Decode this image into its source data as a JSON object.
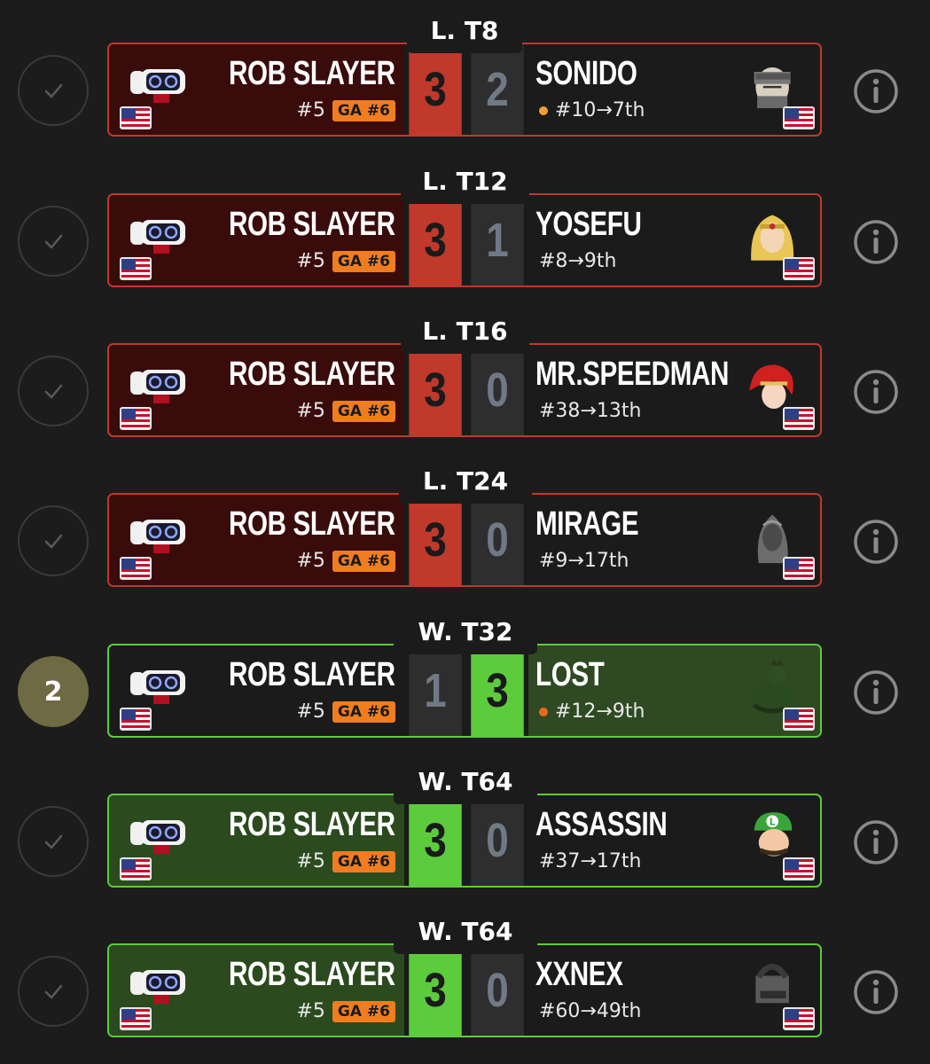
{
  "colors": {
    "loss_red": "#c0392b",
    "win_green": "#5ccc3d",
    "badge_orange": "#f07d20",
    "rank_circle": "#6e6a43",
    "background": "#1c1c1c"
  },
  "player": {
    "name": "ROB SLAYER",
    "seed": "#5",
    "badge": "GA #6",
    "character_icon": "rob-robot-icon",
    "flag_icon": "us-flag-icon"
  },
  "matches": [
    {
      "round": "L. T8",
      "status": "check",
      "player_score": "3",
      "opponent_score": "2",
      "result": "loss-bracket-win",
      "opponent": {
        "name": "SONIDO",
        "placement": "#10→7th",
        "dot": "orange",
        "character_icon": "snake-icon"
      }
    },
    {
      "round": "L. T12",
      "status": "check",
      "player_score": "3",
      "opponent_score": "1",
      "result": "loss-bracket-win",
      "opponent": {
        "name": "YOSEFU",
        "placement": "#8→9th",
        "dot": "",
        "character_icon": "zelda-icon"
      }
    },
    {
      "round": "L. T16",
      "status": "check",
      "player_score": "3",
      "opponent_score": "0",
      "result": "loss-bracket-win",
      "opponent": {
        "name": "MR.SPEEDMAN",
        "placement": "#38→13th",
        "dot": "",
        "character_icon": "roy-icon"
      }
    },
    {
      "round": "L. T24",
      "status": "check",
      "player_score": "3",
      "opponent_score": "0",
      "result": "loss-bracket-win",
      "opponent": {
        "name": "MIRAGE",
        "placement": "#9→17th",
        "dot": "",
        "character_icon": "sephiroth-icon"
      }
    },
    {
      "round": "W. T32",
      "status": "2",
      "player_score": "1",
      "opponent_score": "3",
      "result": "lost",
      "opponent": {
        "name": "LOST",
        "placement": "#12→9th",
        "dot": "red",
        "character_icon": "king-k-rool-icon"
      }
    },
    {
      "round": "W. T64",
      "status": "check",
      "player_score": "3",
      "opponent_score": "0",
      "result": "win",
      "opponent": {
        "name": "ASSASSIN",
        "placement": "#37→17th",
        "dot": "",
        "character_icon": "luigi-icon"
      }
    },
    {
      "round": "W. T64",
      "status": "check",
      "player_score": "3",
      "opponent_score": "0",
      "result": "win",
      "opponent": {
        "name": "XXNEX",
        "placement": "#60→49th",
        "dot": "",
        "character_icon": "steve-icon"
      }
    }
  ]
}
